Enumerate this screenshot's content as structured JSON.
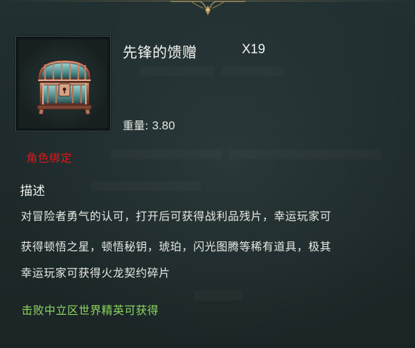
{
  "item": {
    "name": "先锋的馈赠",
    "count": "X19",
    "icon": "treasure-chest-icon",
    "weight_label": "重量:",
    "weight_value": "3.80",
    "binding": "角色绑定"
  },
  "description": {
    "title": "描述",
    "lines": [
      "对冒险者勇气的认可，打开后可获得战利品残片，幸运玩家可",
      "获得顿悟之星，顿悟秘钥，琥珀，闪光图腾等稀有道具，极其",
      "幸运玩家可获得火龙契约碎片"
    ]
  },
  "source": "击败中立区世界精英可获得",
  "colors": {
    "background": "#1d2829",
    "binding": "#e0181c",
    "source": "#8ed861",
    "ornament": "#a08b5a"
  }
}
